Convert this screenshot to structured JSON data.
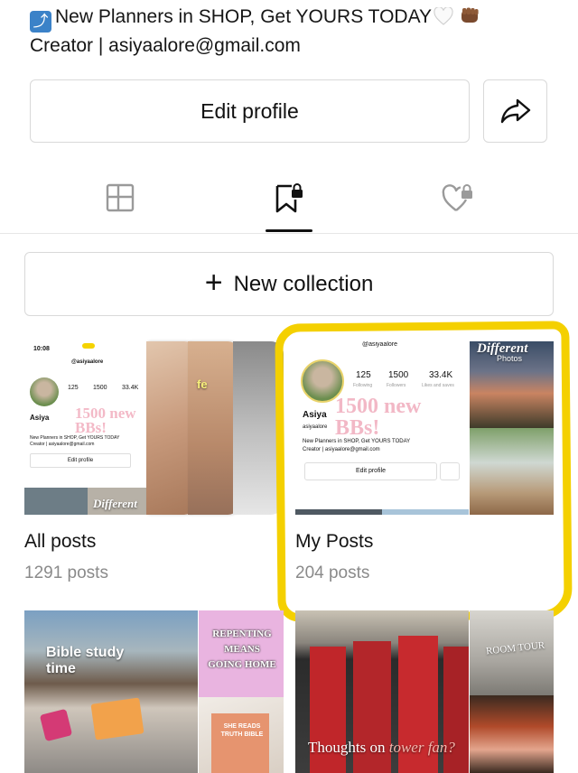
{
  "profile": {
    "bio_line1": "New Planners in SHOP, Get YOURS TODAY",
    "bio_line2": "Creator | asiyaalore@gmail.com"
  },
  "actions": {
    "edit_profile_label": "Edit profile",
    "new_collection_label": "New collection"
  },
  "tabs": [
    {
      "name": "posts-grid",
      "icon": "grid-icon",
      "active": false
    },
    {
      "name": "collections",
      "icon": "bookmark-lock-icon",
      "active": true
    },
    {
      "name": "likes",
      "icon": "heart-lock-icon",
      "active": false
    }
  ],
  "collections": [
    {
      "title": "All posts",
      "count": "1291 posts"
    },
    {
      "title": "My Posts",
      "count": "204 posts"
    }
  ],
  "preview": {
    "time": "10:08",
    "handle": "@asiyaalore",
    "following": "125",
    "following_label": "Following",
    "followers": "1500",
    "followers_label": "Followers",
    "likes": "33.4K",
    "likes_label": "Likes and saves",
    "name": "Asiya",
    "sub_handle": "asiyaalore",
    "bio": "New Planners in SHOP, Get YOURS TODAY",
    "creator": "Creator | asiyaalore@gmail.com",
    "edit": "Edit profile",
    "overlay": "1500 new BBs!"
  },
  "thumb_texts": {
    "different": "Different",
    "photos": "Photos",
    "bible_study": "Bible study time",
    "repenting": "REPENTING MEANS GOING HOME",
    "she_reads": "SHE READS TRUTH BIBLE",
    "room_tour": "ROOM TOUR",
    "thoughts": "Thoughts on",
    "tower_fan": "tower fan?"
  },
  "colors": {
    "highlight": "#f4d000",
    "border": "#d9d9d9",
    "muted": "#8a8a8a"
  }
}
